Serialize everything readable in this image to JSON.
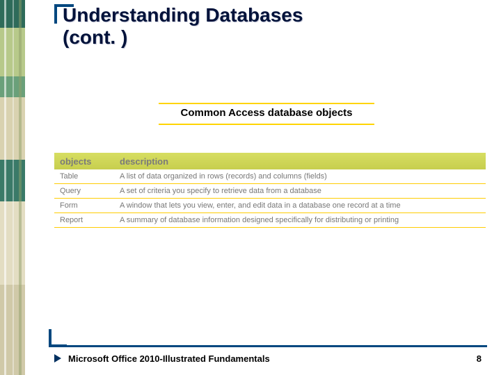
{
  "title_line1": "Understanding Databases",
  "title_line2": "(cont. )",
  "subtitle": "Common Access database objects",
  "table": {
    "head_objects": "objects",
    "head_description": "description",
    "rows": [
      {
        "obj": "Table",
        "desc": "A list of data organized in rows (records) and columns (fields)"
      },
      {
        "obj": "Query",
        "desc": "A set of criteria you specify to retrieve data from a database"
      },
      {
        "obj": "Form",
        "desc": "A window that lets you view, enter, and edit data in a database one record at a time"
      },
      {
        "obj": "Report",
        "desc": "A summary of database information designed specifically for distributing or printing"
      }
    ]
  },
  "footer": "Microsoft Office 2010-Illustrated Fundamentals",
  "page_number": "8"
}
